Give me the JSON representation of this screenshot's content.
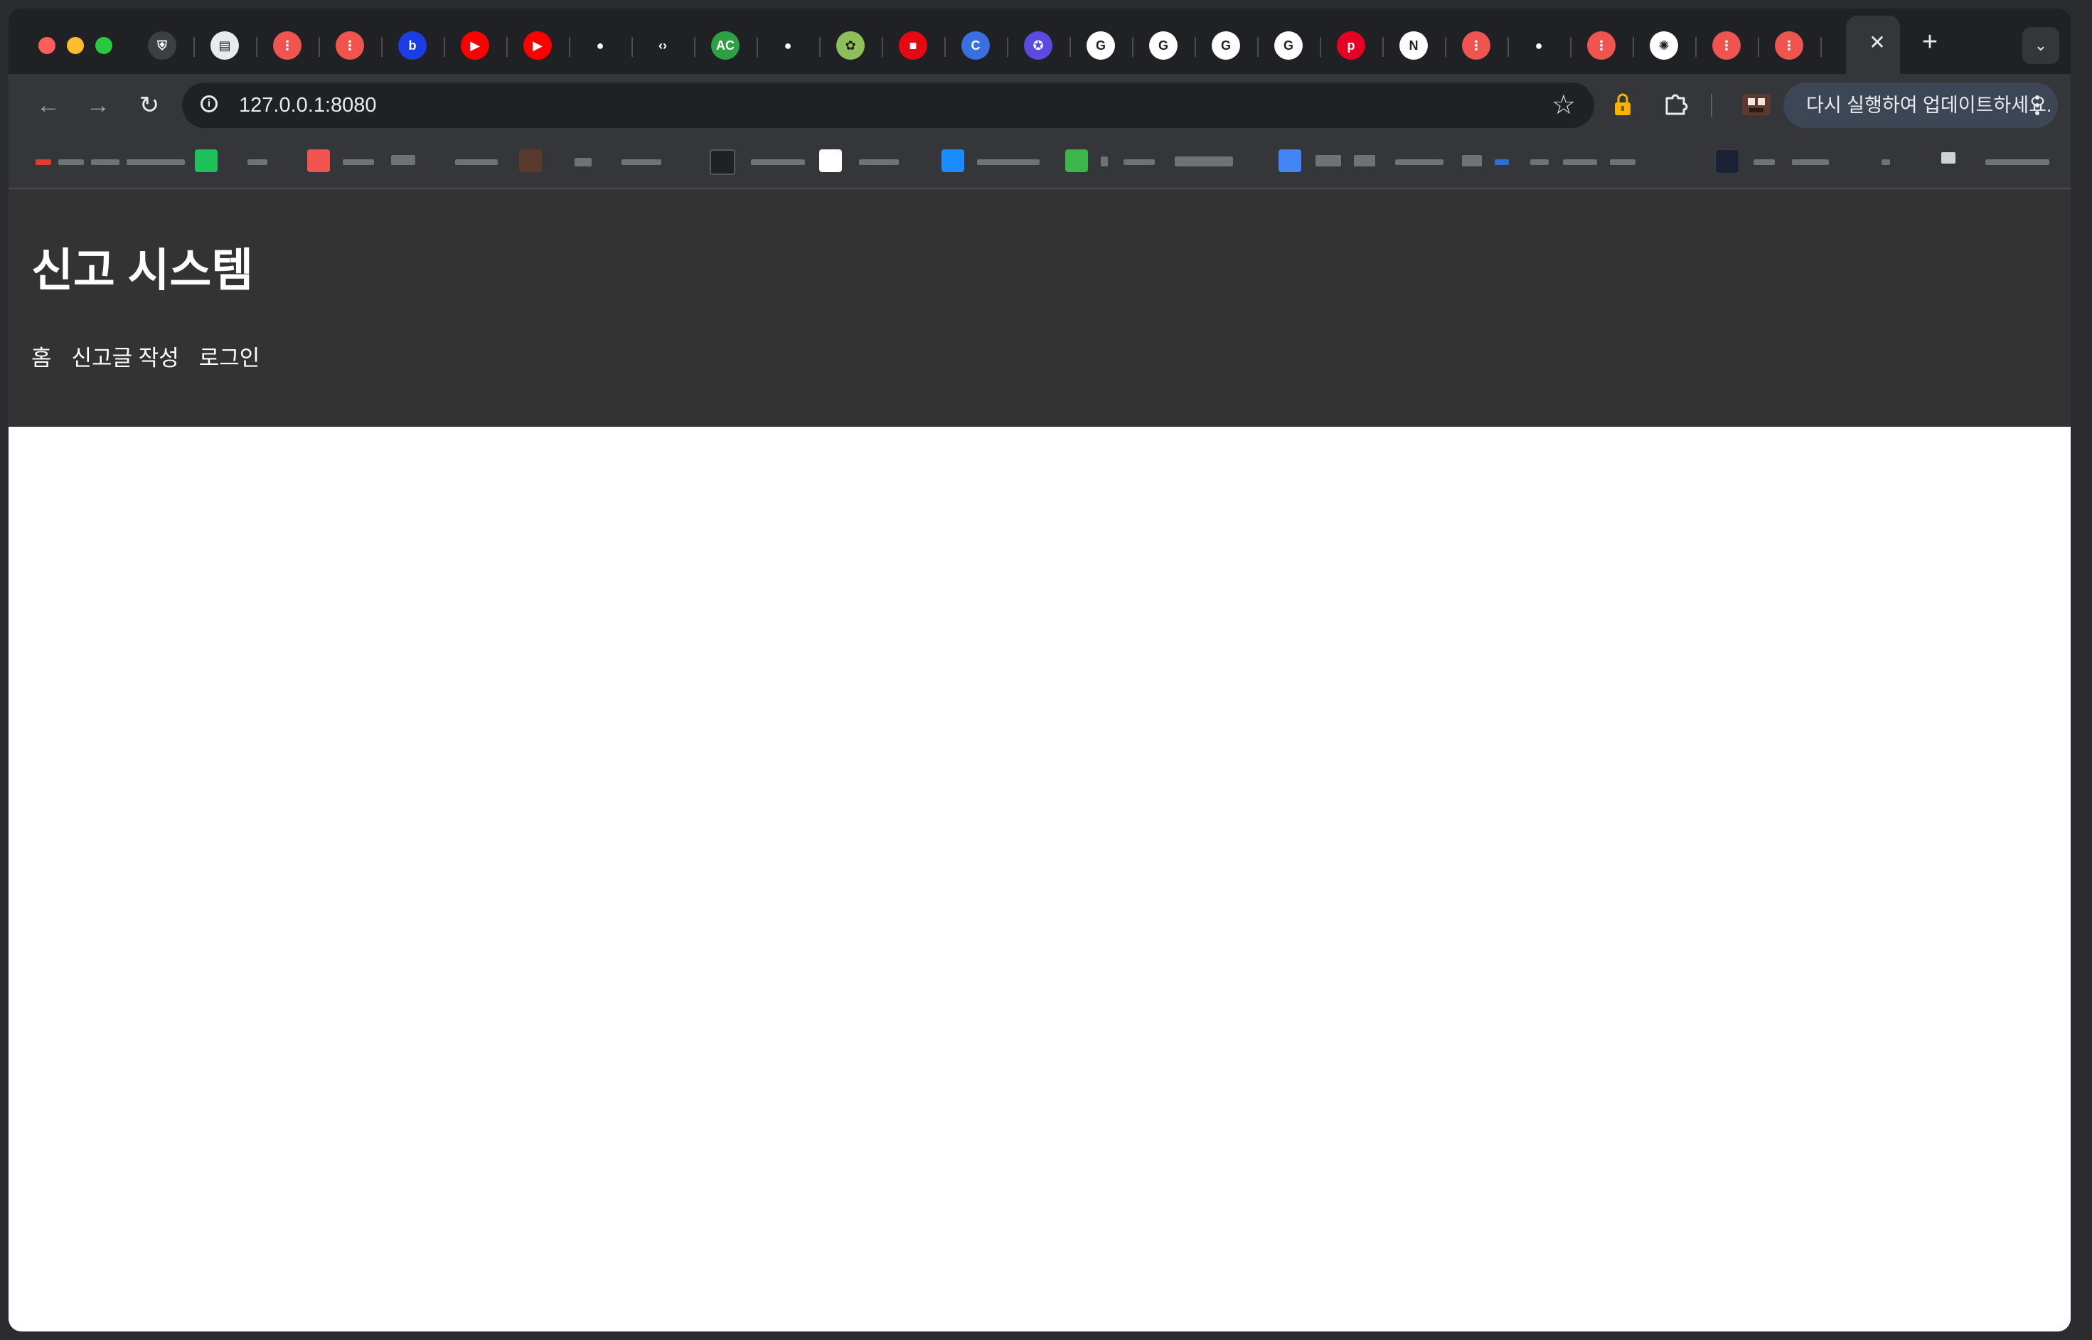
{
  "browser": {
    "address_bar": {
      "url": "127.0.0.1:8080"
    },
    "update_chip": {
      "label": "다시 실행하여 업데이트하세요."
    },
    "tabs": [
      {
        "icon": "shield-icon",
        "color": "#3c4043",
        "glyph": "⛨"
      },
      {
        "icon": "store-icon",
        "color": "#e8eaed",
        "glyph": "▤"
      },
      {
        "icon": "app-red-icon",
        "color": "#f0544f",
        "glyph": "⋮"
      },
      {
        "icon": "app-red-icon",
        "color": "#f0544f",
        "glyph": "⋮"
      },
      {
        "icon": "b-logo-icon",
        "color": "#1a3de6",
        "glyph": "b"
      },
      {
        "icon": "youtube-icon",
        "color": "#ff0000",
        "glyph": "▶"
      },
      {
        "icon": "youtube-icon",
        "color": "#ff0000",
        "glyph": "▶"
      },
      {
        "icon": "github-icon",
        "color": "#202124",
        "glyph": "●"
      },
      {
        "icon": "code-icon",
        "color": "#202124",
        "glyph": "‹›"
      },
      {
        "icon": "ac-icon",
        "color": "#2ea043",
        "glyph": "AC"
      },
      {
        "icon": "github-icon",
        "color": "#202124",
        "glyph": "●"
      },
      {
        "icon": "hamster-icon",
        "color": "#8fbf5a",
        "glyph": "✿"
      },
      {
        "icon": "bank-icon",
        "color": "#e50914",
        "glyph": "■"
      },
      {
        "icon": "canva-icon",
        "color": "#3a6fe0",
        "glyph": "C"
      },
      {
        "icon": "badge-icon",
        "color": "#5b4be0",
        "glyph": "✪"
      },
      {
        "icon": "google-icon",
        "color": "#ffffff",
        "glyph": "G"
      },
      {
        "icon": "google-icon",
        "color": "#ffffff",
        "glyph": "G"
      },
      {
        "icon": "google-icon",
        "color": "#ffffff",
        "glyph": "G"
      },
      {
        "icon": "google-icon",
        "color": "#ffffff",
        "glyph": "G"
      },
      {
        "icon": "pinterest-icon",
        "color": "#e60023",
        "glyph": "p"
      },
      {
        "icon": "notion-icon",
        "color": "#ffffff",
        "glyph": "N"
      },
      {
        "icon": "app-red-icon",
        "color": "#f0544f",
        "glyph": "⋮"
      },
      {
        "icon": "github-icon",
        "color": "#202124",
        "glyph": "●"
      },
      {
        "icon": "app-red-icon",
        "color": "#f0544f",
        "glyph": "⋮"
      },
      {
        "icon": "openai-icon",
        "color": "#ffffff",
        "glyph": "✺"
      },
      {
        "icon": "app-red-icon",
        "color": "#f0544f",
        "glyph": "⋮"
      },
      {
        "icon": "app-red-icon",
        "color": "#f0544f",
        "glyph": "⋮"
      }
    ]
  },
  "site": {
    "title": "신고 시스템",
    "nav": [
      {
        "label": "홈"
      },
      {
        "label": "신고글 작성"
      },
      {
        "label": "로그인"
      }
    ]
  },
  "colors": {
    "site_header_bg": "#333333",
    "page_bg": "#ffffff",
    "toolbar_bg": "#35363a",
    "update_chip_bg": "#3d4654"
  }
}
